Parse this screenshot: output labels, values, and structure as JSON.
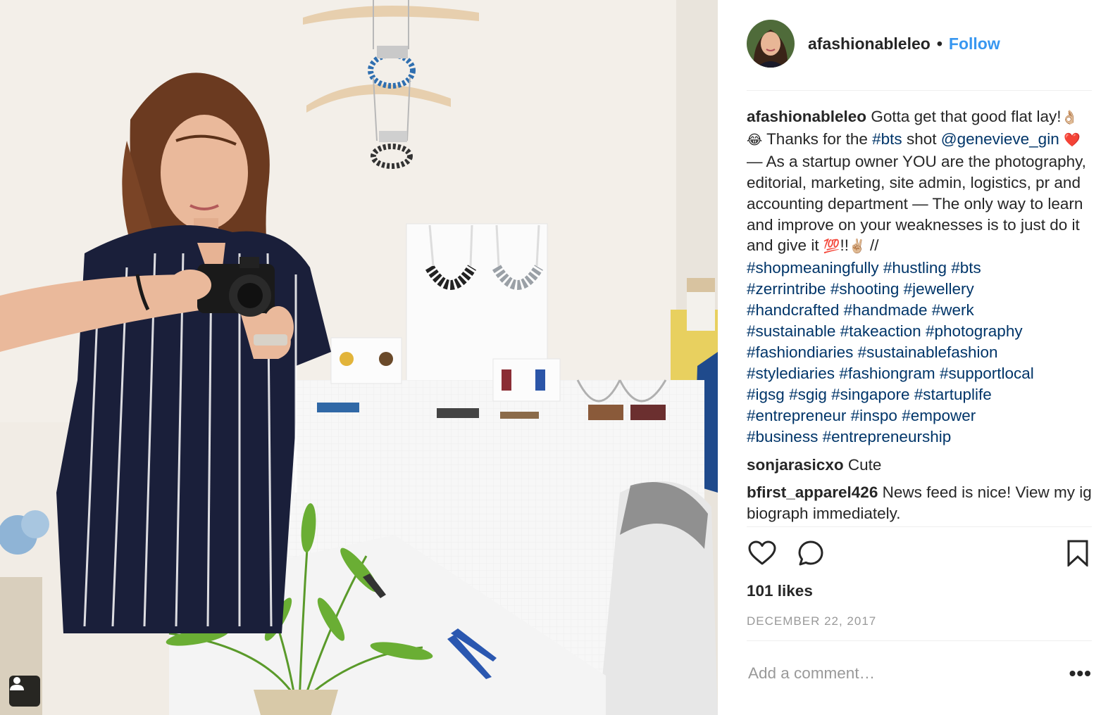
{
  "post": {
    "author": {
      "username": "afashionableleo",
      "separator": "•",
      "follow_label": "Follow"
    },
    "caption": {
      "username": "afashionableleo",
      "t1": "Gotta get that good flat lay!",
      "e1": "👌🏼",
      "e2": "😂",
      "t2": "Thanks for the",
      "tag_bts": "#bts",
      "t3": "shot",
      "mention": "@genevieve_gin",
      "e3": "❤️",
      "t4": "— As a startup owner YOU are the photography, editorial, marketing, site admin, logistics, pr and accounting department — The only way to learn and improve on your weaknesses is to just do it and give it",
      "e4": "💯",
      "t5": "!!",
      "e5": "✌🏼",
      "t6": "//",
      "hashtags": [
        "#shopmeaningfully",
        "#hustling",
        "#bts",
        "#zerrintribe",
        "#shooting",
        "#jewellery",
        "#handcrafted",
        "#handmade",
        "#werk",
        "#sustainable",
        "#takeaction",
        "#photography",
        "#fashiondiaries",
        "#sustainablefashion",
        "#stylediaries",
        "#fashiongram",
        "#supportlocal",
        "#igsg",
        "#sgig",
        "#singapore",
        "#startuplife",
        "#entrepreneur",
        "#inspo",
        "#empower",
        "#business",
        "#entrepreneurship"
      ]
    },
    "comments": [
      {
        "username": "sonjarasicxo",
        "text": "Cute"
      },
      {
        "username": "bfirst_apparel426",
        "text": "News feed is nice! View my ig biograph immediately."
      }
    ],
    "likes_label": "101 likes",
    "date": "DECEMBER 22, 2017",
    "add_comment_placeholder": "Add a comment…",
    "more_label": "•••",
    "icons": {
      "like": "heart-outline-icon",
      "comment": "speech-bubble-icon",
      "save": "bookmark-icon",
      "tagged_user": "person-icon",
      "more": "ellipsis-icon"
    },
    "colors": {
      "link": "#003569",
      "follow": "#3897f0",
      "muted": "#999999",
      "text": "#262626"
    }
  }
}
